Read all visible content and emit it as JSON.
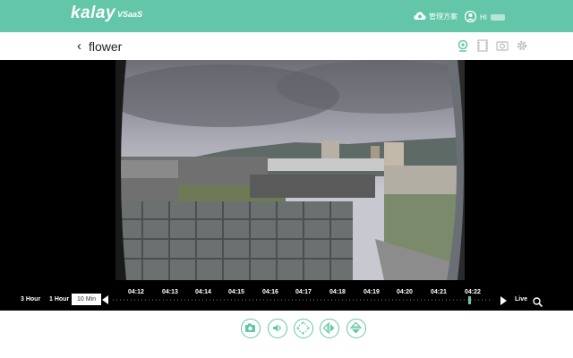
{
  "brand": {
    "logo": "kalay",
    "sub": "VSaaS",
    "accent": "#63c6a8"
  },
  "topbar": {
    "plan_label": "管理方案",
    "user_label": "HI"
  },
  "header": {
    "back_icon": "chevron-left-icon",
    "title": "flower",
    "icons": [
      "webcam-icon",
      "filmstrip-icon",
      "camera-settings-icon",
      "gear-icon"
    ]
  },
  "timeline": {
    "range_buttons": [
      "3 Hour",
      "1 Hour",
      "10 Min"
    ],
    "selected_range": "10 Min",
    "ticks": [
      "04:12",
      "04:13",
      "04:14",
      "04:15",
      "04:16",
      "04:17",
      "04:18",
      "04:19",
      "04:20",
      "04:21",
      "04:22"
    ],
    "live_label": "Live"
  },
  "controls": [
    "snapshot-icon",
    "speaker-icon",
    "ptz-icon",
    "flip-horizontal-icon",
    "flip-vertical-icon"
  ]
}
